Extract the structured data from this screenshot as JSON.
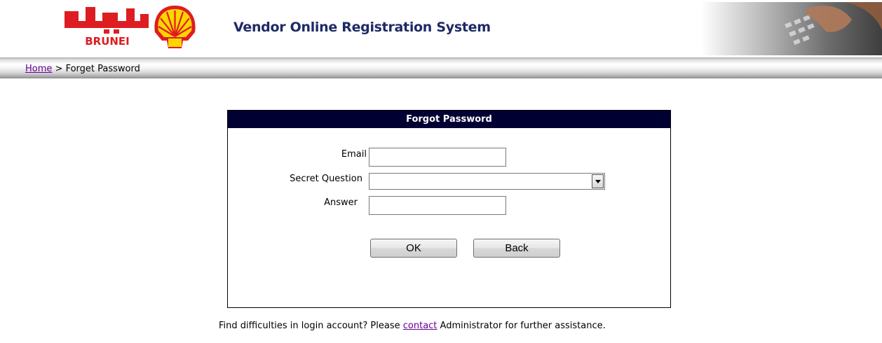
{
  "header": {
    "logo_name": "BRUNEI",
    "app_title": "Vendor Online Registration System"
  },
  "breadcrumb": {
    "home_link": "Home",
    "separator": ">",
    "current": "Forget Password"
  },
  "form": {
    "title": "Forgot Password",
    "email_label": "Email",
    "email_value": "",
    "question_label": "Secret Question",
    "question_value": "",
    "answer_label": "Answer",
    "answer_value": "",
    "ok_label": "OK",
    "back_label": "Back"
  },
  "help": {
    "prefix": "Find difficulties in login account? Please",
    "link": "contact",
    "suffix": "Administrator for further assistance."
  },
  "colors": {
    "title_bar": "#000033",
    "app_title": "#1d2a66",
    "link": "#660099",
    "shell_red": "#dd1d21",
    "shell_yellow": "#ffd500"
  },
  "icons": [
    "shell-logo-icon",
    "dropdown-arrow-icon",
    "keyboard-photo"
  ]
}
